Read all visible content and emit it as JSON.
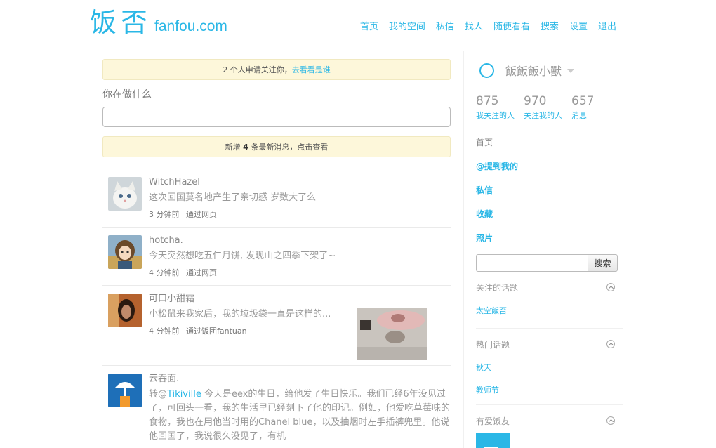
{
  "header": {
    "logo_cn": "饭否",
    "logo_en": "fanfou.com",
    "nav": [
      "首页",
      "我的空间",
      "私信",
      "找人",
      "随便看看",
      "搜索",
      "设置",
      "退出"
    ]
  },
  "main": {
    "follow_notice": {
      "text": "2 个人申请关注你，",
      "link": "去看看是谁"
    },
    "prompt": "你在做什么",
    "new_notice": {
      "prefix": "新增 ",
      "count": "4",
      "suffix": " 条最新消息，点击查看"
    },
    "messages": [
      {
        "author": "WitchHazel",
        "content": "这次回国莫名地产生了亲切感 岁数大了么",
        "time": "3 分钟前",
        "source": "通过网页"
      },
      {
        "author": "hotcha.",
        "content": "今天突然想吃五仁月饼, 发现山之四季下架了~",
        "time": "4 分钟前",
        "source": "通过网页"
      },
      {
        "author": "可口小甜霜",
        "content": "小松鼠来我家后，我的垃圾袋一直是这样的...",
        "time": "4 分钟前",
        "source": "通过饭团fantuan"
      },
      {
        "author": "云吞面.",
        "content_pre": "转@",
        "mention": "Tikiville",
        "content": " 今天是eex的生日，给他发了生日快乐。我们已经6年没见过了，可回头一看，我的生活里已经刻下了他的印记。例如，他爱吃草莓味的食物，我也在用他当时用的Chanel blue，以及抽烟时左手插裤兜里。他说他回国了，我说很久没见了，有机"
      }
    ]
  },
  "sidebar": {
    "username": "飯飯飯小獸",
    "stats": [
      {
        "num": "875",
        "label": "我关注的人"
      },
      {
        "num": "970",
        "label": "关注我的人"
      },
      {
        "num": "657",
        "label": "消息"
      }
    ],
    "home": "首页",
    "nav": [
      "@提到我的",
      "私信",
      "收藏",
      "照片"
    ],
    "search_button": "搜索",
    "sections": [
      {
        "title": "关注的话题",
        "items": [
          "太空飯否"
        ]
      },
      {
        "title": "热门话题",
        "items": [
          "秋天",
          "教师节"
        ]
      },
      {
        "title": "有爱饭友",
        "items": []
      }
    ]
  },
  "colors": {
    "accent": "#2ab7e6",
    "notice_bg": "#fdf7da"
  }
}
